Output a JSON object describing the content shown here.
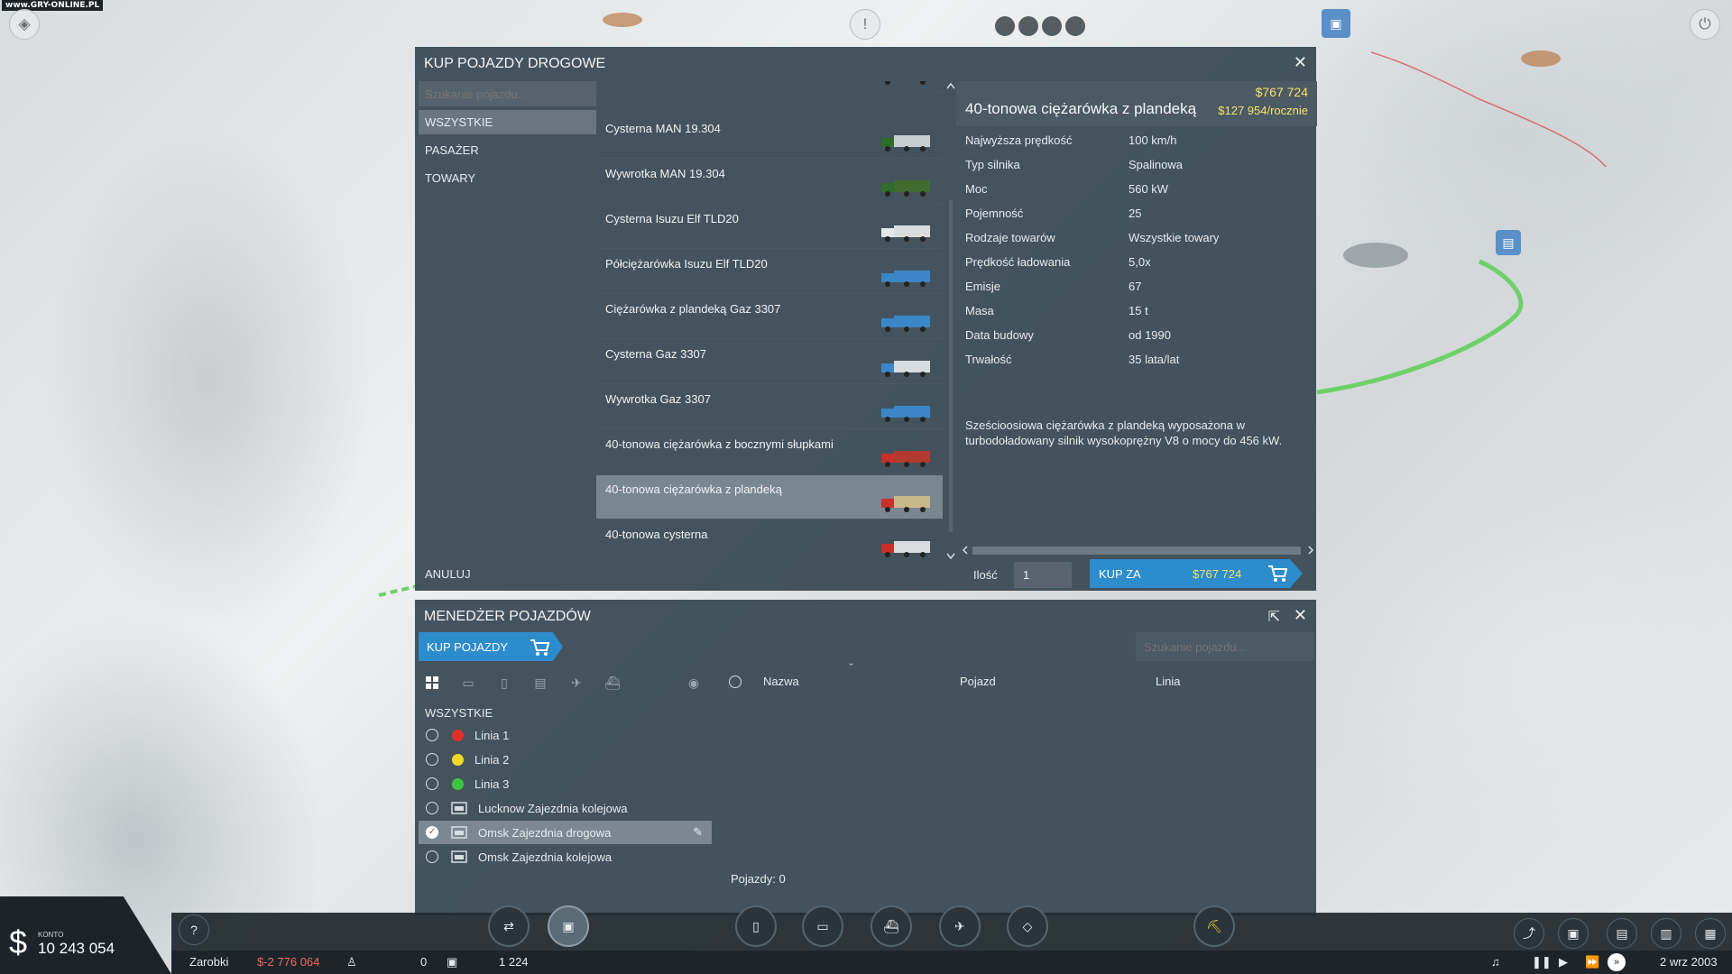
{
  "watermark": "www.GRY-ONLINE.PL",
  "buy_dialog": {
    "title": "KUP POJAZDY DROGOWE",
    "close": "✕",
    "search_placeholder": "Szukanie pojazdu...",
    "categories": [
      {
        "label": "WSZYSTKIE",
        "active": true
      },
      {
        "label": "PASAŻER",
        "active": false
      },
      {
        "label": "TOWARY",
        "active": false
      }
    ],
    "cancel_label": "ANULUJ",
    "vehicles": [
      {
        "name": "Cysterna MAN 19.304",
        "color": "#c8cdd0",
        "cab": "#2f6e2a"
      },
      {
        "name": "Wywrotka MAN 19.304",
        "color": "#3f6b2e",
        "cab": "#2f6e2a"
      },
      {
        "name": "Cysterna Isuzu Elf TLD20",
        "color": "#d9dcde",
        "cab": "#e5e7e8"
      },
      {
        "name": "Półciężarówka Isuzu Elf TLD20",
        "color": "#3b86c7",
        "cab": "#3b86c7"
      },
      {
        "name": "Ciężarówka z plandeką Gaz 3307",
        "color": "#3b86c7",
        "cab": "#3b86c7"
      },
      {
        "name": "Cysterna Gaz 3307",
        "color": "#d9dcde",
        "cab": "#3b86c7"
      },
      {
        "name": "Wywrotka Gaz 3307",
        "color": "#3b86c7",
        "cab": "#3b86c7"
      },
      {
        "name": "40-tonowa ciężarówka z bocznymi słupkami",
        "color": "#b33a2e",
        "cab": "#c9302c"
      },
      {
        "name": "40-tonowa ciężarówka z plandeką",
        "color": "#c9b98a",
        "cab": "#c9302c",
        "selected": true
      },
      {
        "name": "40-tonowa cysterna",
        "color": "#d9dcde",
        "cab": "#c9302c"
      }
    ],
    "detail": {
      "price": "$767 724",
      "name": "40-tonowa ciężarówka z plandeką",
      "yearly": "$127 954/rocznie",
      "specs": [
        {
          "k": "Najwyższa prędkość",
          "v": "100 km/h"
        },
        {
          "k": "Typ silnika",
          "v": "Spalinowa"
        },
        {
          "k": "Moc",
          "v": "560 kW"
        },
        {
          "k": "Pojemność",
          "v": "25"
        },
        {
          "k": "Rodzaje towarów",
          "v": "Wszystkie towary"
        },
        {
          "k": "Prędkość ładowania",
          "v": "5,0x"
        },
        {
          "k": "Emisje",
          "v": "67"
        },
        {
          "k": "Masa",
          "v": "15 t"
        },
        {
          "k": "Data budowy",
          "v": "od 1990"
        },
        {
          "k": "Trwałość",
          "v": "35 lata/lat"
        }
      ],
      "description": "Sześcioosiowa ciężarówka z plandeką wyposażona w turbodoładowany silnik wysokoprężny V8 o mocy do 456 kW."
    },
    "qty_label": "Ilość",
    "qty_value": "1",
    "buy_label": "KUP ZA",
    "buy_price": "$767 724"
  },
  "manager": {
    "title": "MENEDŻER POJAZDÓW",
    "buy_button": "KUP POJAZDY",
    "search_placeholder": "Szukanie pojazdu...",
    "columns": {
      "name": "Nazwa",
      "vehicle": "Pojazd",
      "line": "Linia"
    },
    "group_title": "WSZYSTKIE",
    "groups": [
      {
        "label": "Linia 1",
        "kind": "line",
        "color": "#e0302a"
      },
      {
        "label": "Linia 2",
        "kind": "line",
        "color": "#f1d82b"
      },
      {
        "label": "Linia 3",
        "kind": "line",
        "color": "#3fc43f"
      },
      {
        "label": "Lucknow Zajezdnia kolejowa",
        "kind": "depot"
      },
      {
        "label": "Omsk Zajezdnia drogowa",
        "kind": "depot",
        "selected": true
      },
      {
        "label": "Omsk Zajezdnia kolejowa",
        "kind": "depot"
      }
    ],
    "count": "Pojazdy: 0"
  },
  "status": {
    "account_label": "KONTO",
    "account_value": "10 243 054",
    "earnings_label": "Zarobki",
    "earnings_value": "$-2 776 064",
    "passengers": "0",
    "cargo": "1 224",
    "date": "2 wrz 2003"
  }
}
